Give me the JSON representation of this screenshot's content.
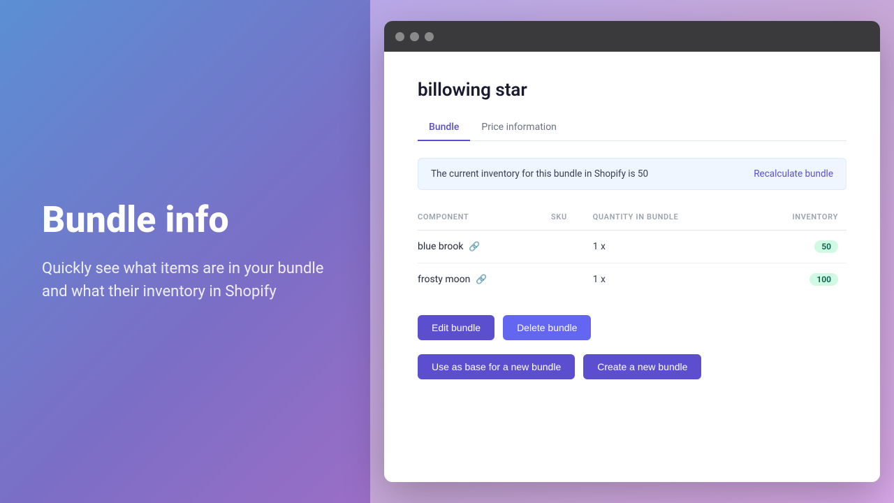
{
  "leftPanel": {
    "heading": "Bundle info",
    "description": "Quickly see what items are in your bundle and what their inventory in Shopify"
  },
  "browserWindow": {
    "pageTitle": "billowing star",
    "tabs": [
      {
        "label": "Bundle",
        "active": true
      },
      {
        "label": "Price information",
        "active": false
      }
    ],
    "infoBanner": {
      "text": "The current inventory for this bundle in Shopify is 50",
      "actionLabel": "Recalculate bundle"
    },
    "table": {
      "columns": [
        {
          "label": "COMPONENT"
        },
        {
          "label": "SKU"
        },
        {
          "label": "QUANTITY IN BUNDLE"
        },
        {
          "label": "INVENTORY"
        }
      ],
      "rows": [
        {
          "component": "blue brook",
          "sku": "",
          "quantity": "1 x",
          "inventory": "50",
          "inventoryColor": "green"
        },
        {
          "component": "frosty moon",
          "sku": "",
          "quantity": "1 x",
          "inventory": "100",
          "inventoryColor": "green"
        }
      ]
    },
    "buttons": {
      "editBundle": "Edit bundle",
      "deleteBundle": "Delete bundle",
      "useAsBase": "Use as base for a new bundle",
      "createNew": "Create a new bundle"
    }
  },
  "trafficLights": [
    "close",
    "minimize",
    "maximize"
  ],
  "icons": {
    "linkIcon": "🔗"
  }
}
